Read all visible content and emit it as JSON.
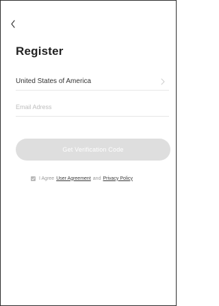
{
  "header": {
    "back_icon": "chevron-left-icon",
    "title": "Register"
  },
  "form": {
    "country": "United States of America",
    "country_chevron_icon": "chevron-right-icon",
    "email_placeholder": "Email Adress",
    "email_value": "",
    "verify_button_label": "Get Verification Code"
  },
  "agreement": {
    "prefix": "I Agree",
    "user_agreement_link": "User Agreement",
    "conjunction": "and",
    "privacy_policy_link": "Privacy Policy",
    "checked": true
  },
  "colors": {
    "button_disabled": "#dedede",
    "divider": "#e6e6e6",
    "checkbox": "#b8b8b8"
  }
}
